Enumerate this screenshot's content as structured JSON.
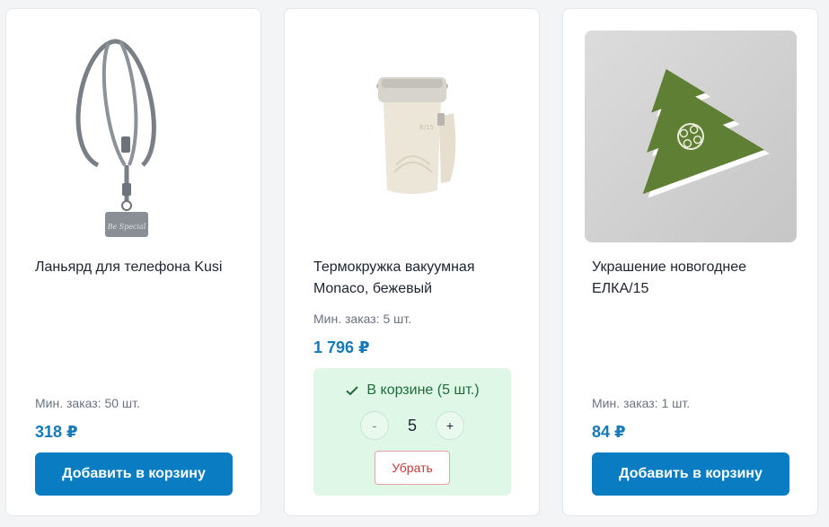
{
  "products": [
    {
      "title": "Ланьярд для телефона Kusi",
      "min_order": "Мин. заказ: 50 шт.",
      "price": "318 ₽",
      "add_label": "Добавить в корзину"
    },
    {
      "title": "Термокружка вакуумная Monaco, бежевый",
      "min_order": "Мин. заказ: 5 шт.",
      "price": "1 796 ₽",
      "in_cart_label": "В корзине (5 шт.)",
      "minus": "-",
      "quantity": "5",
      "plus": "+",
      "remove_label": "Убрать"
    },
    {
      "title": "Украшение новогоднее ЕЛКА/15",
      "min_order": "Мин. заказ: 1 шт.",
      "price": "84 ₽",
      "add_label": "Добавить в корзину"
    }
  ],
  "colors": {
    "accent": "#0a7cc1",
    "price": "#1679b8",
    "in_cart_bg": "#dff7e6",
    "remove": "#c43a3a"
  },
  "icons": [
    "phone-lanyard-image",
    "thermo-mug-image",
    "christmas-tree-ornament-image",
    "check-icon"
  ]
}
